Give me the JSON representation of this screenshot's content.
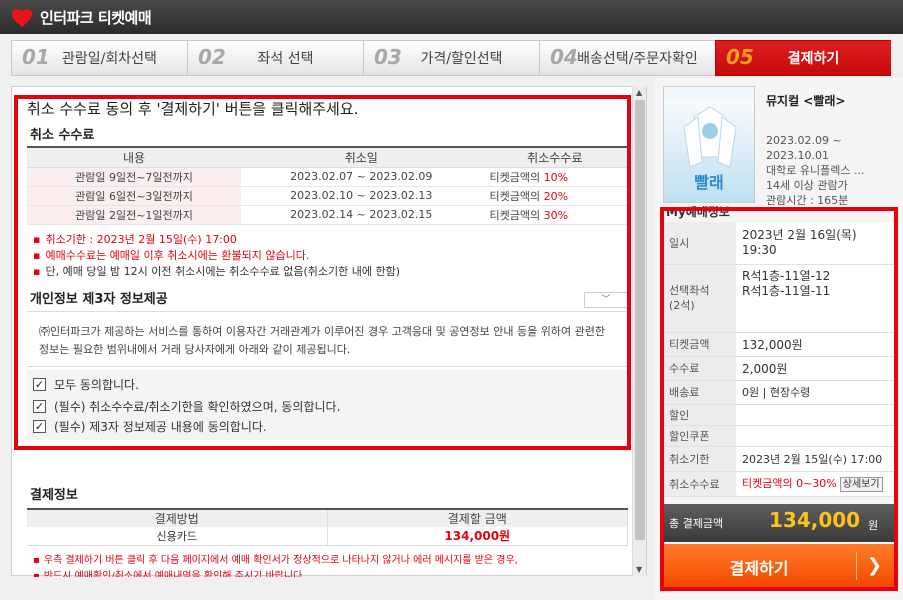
{
  "header": {
    "brand": "인터파크 티켓예매"
  },
  "steps": [
    {
      "num": "01",
      "label": "관람일/회차선택"
    },
    {
      "num": "02",
      "label": "좌석 선택"
    },
    {
      "num": "03",
      "label": "가격/할인선택"
    },
    {
      "num": "04",
      "label": "배송선택/주문자확인"
    },
    {
      "num": "05",
      "label": "결제하기"
    }
  ],
  "main": {
    "intro": "취소 수수료 동의 후 '결제하기' 버튼을 클릭해주세요.",
    "cancel_fee_title": "취소 수수료",
    "fee_headers": [
      "내용",
      "취소일",
      "취소수수료"
    ],
    "fee_rows": [
      {
        "content": "관람일 9일전~7일전까지",
        "date": "2023.02.07 ~ 2023.02.09",
        "fee_prefix": "티켓금액의",
        "pct": "10%"
      },
      {
        "content": "관람일 6일전~3일전까지",
        "date": "2023.02.10 ~ 2023.02.13",
        "fee_prefix": "티켓금액의",
        "pct": "20%"
      },
      {
        "content": "관람일 2일전~1일전까지",
        "date": "2023.02.14 ~ 2023.02.15",
        "fee_prefix": "티켓금액의",
        "pct": "30%"
      }
    ],
    "notes": [
      "취소기한 : 2023년 2월 15일(수) 17:00",
      "예매수수료는 예매일 이후 취소시에는 환불되지 않습니다.",
      "단, 예매 당일 밤 12시 이전 취소시에는 취소수수료 없음(취소기한 내에 한함)"
    ],
    "privacy_title": "개인정보 제3자 정보제공",
    "privacy_text": "㈜인터파크가 제공하는 서비스를 통하여 이용자간 거래관계가 이루어진 경우 고객응대 및 공연정보 안내 등을 위하여 관련한 정보는 필요한 범위내에서 거래 당사자에게 아래와 같이 제공됩니다.",
    "agreements": [
      "모두 동의합니다.",
      "(필수) 취소수수료/취소기한을 확인하였으며, 동의합니다.",
      "(필수) 제3자 정보제공 내용에 동의합니다."
    ],
    "payment_title": "결제정보",
    "pay_headers": [
      "결제방법",
      "결제할 금액"
    ],
    "pay_method": "신용카드",
    "pay_amount": "134,000원",
    "bottom_notes": [
      "우측 결제하기 버튼 클릭 후 다음 페이지에서 예매 확인서가 정상적으로 나타나지 않거나 에러 메시지를 받은 경우,",
      "반드시 예매확인/취소에서 예매내역을 확인해 주시기 바랍니다."
    ]
  },
  "sidebar": {
    "poster_title": "빨래",
    "show_title": "뮤지컬 <빨래>",
    "show_info": [
      "2023.02.09 ~",
      "2023.10.01",
      "대학로 유니플렉스 ...",
      "14세 이상 관람가",
      "관람시간 : 165분"
    ],
    "my_title": "My예매정보",
    "rows": {
      "datetime_label": "일시",
      "datetime_1": "2023년 2월 16일(목)",
      "datetime_2": "19:30",
      "seat_label_1": "선택좌석",
      "seat_label_2": "(2석)",
      "seat_1": "R석1층-11열-12",
      "seat_2": "R석1층-11열-11",
      "ticket_label": "티켓금액",
      "ticket": "132,000원",
      "fee_label": "수수료",
      "fee": "2,000원",
      "delivery_label": "배송료",
      "delivery": "0원 | 현장수령",
      "discount_label": "할인",
      "coupon_label": "할인쿠폰",
      "deadline_label": "취소기한",
      "deadline": "2023년 2월 15일(수) 17:00",
      "cancel_fee_label": "취소수수료",
      "cancel_fee": "티켓금액의 0~30%",
      "detail_btn": "상세보기"
    },
    "total_label": "총 결제금액",
    "total_amount": "134,000",
    "total_unit": "원",
    "pay_button": "결제하기"
  }
}
